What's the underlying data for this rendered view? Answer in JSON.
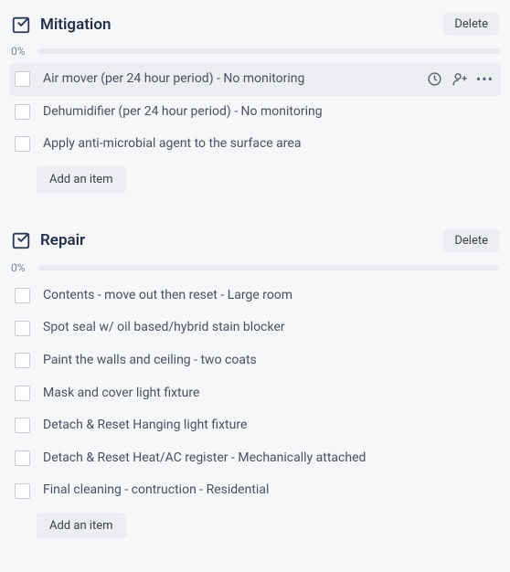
{
  "sections": [
    {
      "title": "Mitigation",
      "delete_label": "Delete",
      "progress": "0%",
      "add_label": "Add an item",
      "items": [
        {
          "label": "Air mover (per 24 hour period) - No monitoring",
          "highlight": true,
          "show_actions": true
        },
        {
          "label": "Dehumidifier (per 24 hour period) - No monitoring",
          "highlight": false,
          "show_actions": false
        },
        {
          "label": "Apply anti-microbial agent to the surface area",
          "highlight": false,
          "show_actions": false
        }
      ]
    },
    {
      "title": "Repair",
      "delete_label": "Delete",
      "progress": "0%",
      "add_label": "Add an item",
      "items": [
        {
          "label": "Contents - move out then reset - Large room",
          "highlight": false,
          "show_actions": false
        },
        {
          "label": "Spot seal w/ oil based/hybrid stain blocker",
          "highlight": false,
          "show_actions": false
        },
        {
          "label": "Paint the walls and ceiling - two coats",
          "highlight": false,
          "show_actions": false
        },
        {
          "label": "Mask and cover light fixture",
          "highlight": false,
          "show_actions": false
        },
        {
          "label": "Detach & Reset Hanging light fixture",
          "highlight": false,
          "show_actions": false
        },
        {
          "label": "Detach & Reset Heat/AC register - Mechanically attached",
          "highlight": false,
          "show_actions": false
        },
        {
          "label": "Final cleaning - contruction - Residential",
          "highlight": false,
          "show_actions": false
        }
      ]
    }
  ]
}
